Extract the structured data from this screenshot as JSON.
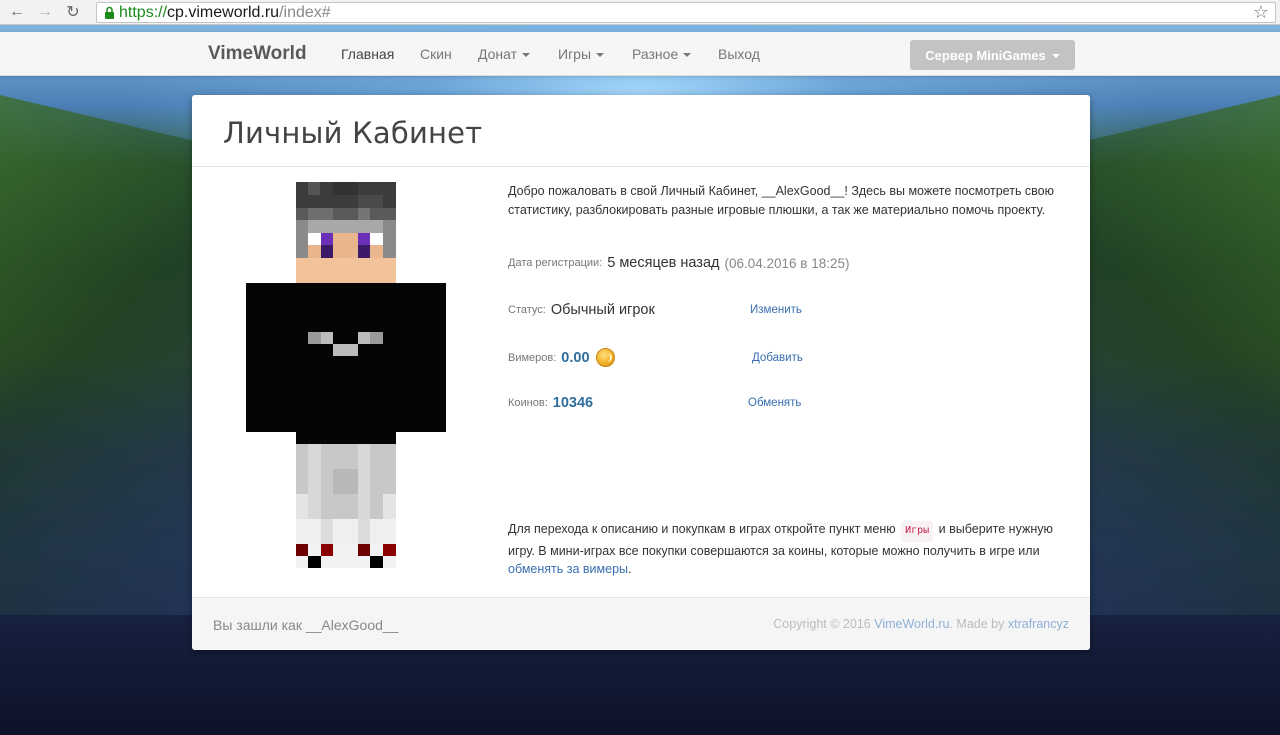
{
  "browser": {
    "url_scheme": "https://",
    "url_host": "cp.vimeworld.ru",
    "url_path": "/index#"
  },
  "navbar": {
    "brand": "VimeWorld",
    "items": [
      {
        "label": "Главная",
        "dropdown": false,
        "active": true
      },
      {
        "label": "Скин",
        "dropdown": false,
        "active": false
      },
      {
        "label": "Донат",
        "dropdown": true,
        "active": false
      },
      {
        "label": "Игры",
        "dropdown": true,
        "active": false
      },
      {
        "label": "Разное",
        "dropdown": true,
        "active": false
      },
      {
        "label": "Выход",
        "dropdown": false,
        "active": false
      }
    ],
    "server_button": "Сервер MiniGames"
  },
  "card": {
    "title": "Личный Кабинет",
    "welcome": "Добро пожаловать в свой Личный Кабинет, __AlexGood__! Здесь вы можете посмотреть свою статистику, разблокировать разные игровые плюшки, а так же материально помочь проекту.",
    "registration": {
      "label": "Дата регистрации:",
      "value": "5 месяцев назад",
      "date": "(06.04.2016 в 18:25)"
    },
    "status": {
      "label": "Статус:",
      "value": "Обычный игрок",
      "action": "Изменить"
    },
    "vimers": {
      "label": "Вимеров:",
      "value": "0.00",
      "action": "Добавить"
    },
    "coins": {
      "label": "Коинов:",
      "value": "10346",
      "action": "Обменять"
    },
    "footnote": {
      "part1": "Для перехода к описанию и покупкам в играх откройте пункт меню",
      "code": "Игры",
      "part2": "и выберите нужную игру. В мини-играх все покупки совершаются за коины, которые можно получить в игре или",
      "link": "обменять за вимеры",
      "end": "."
    }
  },
  "footer": {
    "logged_in_prefix": "Вы зашли как",
    "username": "__AlexGood__",
    "copyright_prefix": "Copyright © 2016",
    "site_link": "VimeWorld.ru",
    "made_by_prefix": ". Made by",
    "author_link": "xtrafrancyz"
  },
  "colors": {
    "link": "#3a6eb0",
    "number": "#2f6e9e",
    "server_button": "#c3c3c3"
  }
}
